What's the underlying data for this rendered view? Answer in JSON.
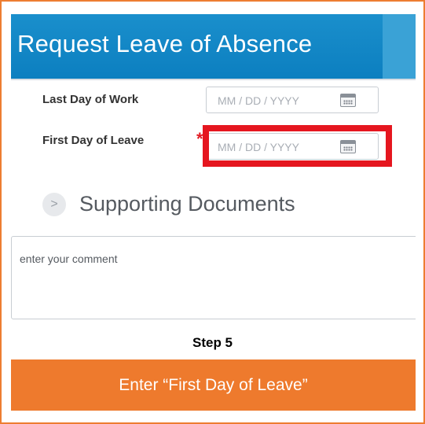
{
  "header": {
    "title": "Request Leave of Absence"
  },
  "form": {
    "last_day_label": "Last Day of Work",
    "last_day_placeholder": "MM / DD / YYYY",
    "first_day_label": "First Day of Leave",
    "required_marker": "*",
    "first_day_placeholder": "MM / DD / YYYY"
  },
  "section": {
    "expand_glyph": ">",
    "title": "Supporting Documents"
  },
  "comment": {
    "placeholder": "enter your comment"
  },
  "caption": {
    "step": "Step 5",
    "instruction": "Enter “First Day of Leave”"
  },
  "colors": {
    "header_blue": "#0c7fc0",
    "highlight_red": "#e5161f",
    "banner_orange": "#ee7a2d",
    "frame_orange": "#ed7d31"
  },
  "icons": {
    "date_picker": "calendar-icon",
    "section_toggle": "chevron-right-icon"
  }
}
